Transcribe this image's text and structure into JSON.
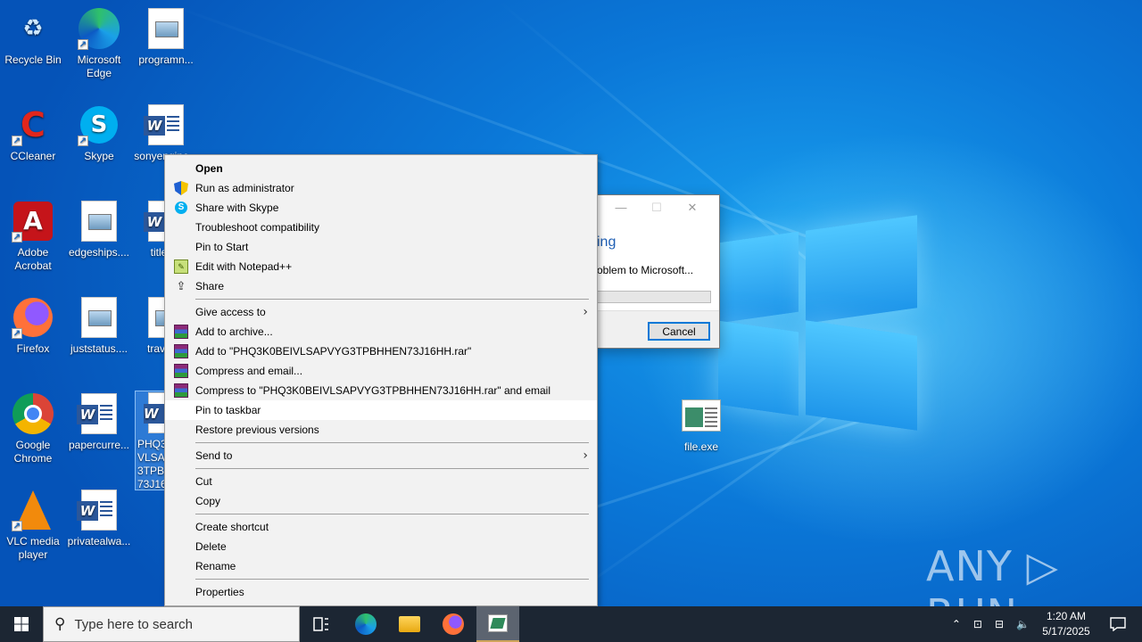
{
  "desktop_icons": [
    {
      "label": "Recycle Bin"
    },
    {
      "label": "Microsoft Edge"
    },
    {
      "label": "programn..."
    },
    {
      "label": "CCleaner"
    },
    {
      "label": "Skype"
    },
    {
      "label": "sonyengine..."
    },
    {
      "label": "Adobe Acrobat"
    },
    {
      "label": "edgeships...."
    },
    {
      "label": "titles..."
    },
    {
      "label": "Firefox"
    },
    {
      "label": "juststatus...."
    },
    {
      "label": "travell..."
    },
    {
      "label": "Google Chrome"
    },
    {
      "label": "papercurre..."
    },
    {
      "label": "PHQ3K0BEIVLSAPVYG3TPBHHEN73J16HH"
    },
    {
      "label": "VLC media player"
    },
    {
      "label": "privatealwa..."
    },
    {
      "label": "file.exe"
    }
  ],
  "dialog": {
    "heading": "ing",
    "message": "oblem to Microsoft...",
    "cancel_label": "Cancel",
    "minimize_icon": "—",
    "maximize_icon": "☐",
    "close_icon": "✕"
  },
  "context_menu": {
    "items": [
      {
        "label": "Open"
      },
      {
        "label": "Run as administrator"
      },
      {
        "label": "Share with Skype"
      },
      {
        "label": "Troubleshoot compatibility"
      },
      {
        "label": "Pin to Start"
      },
      {
        "label": "Edit with Notepad++"
      },
      {
        "label": "Share"
      },
      {
        "label": "Give access to"
      },
      {
        "label": "Add to archive..."
      },
      {
        "label": "Add to \"PHQ3K0BEIVLSAPVYG3TPBHHEN73J16HH.rar\""
      },
      {
        "label": "Compress and email..."
      },
      {
        "label": "Compress to \"PHQ3K0BEIVLSAPVYG3TPBHHEN73J16HH.rar\" and email"
      },
      {
        "label": "Pin to taskbar"
      },
      {
        "label": "Restore previous versions"
      },
      {
        "label": "Send to"
      },
      {
        "label": "Cut"
      },
      {
        "label": "Copy"
      },
      {
        "label": "Create shortcut"
      },
      {
        "label": "Delete"
      },
      {
        "label": "Rename"
      },
      {
        "label": "Properties"
      }
    ],
    "submenu_arrow": "›"
  },
  "taskbar": {
    "search_placeholder": "Type here to search",
    "time": "1:20 AM",
    "date": "5/17/2025"
  },
  "watermark": "ANY ▷ RUN",
  "colors": {
    "accent": "#0078d7",
    "taskbar": "#1c2633",
    "menu_bg": "#f2f2f2"
  }
}
